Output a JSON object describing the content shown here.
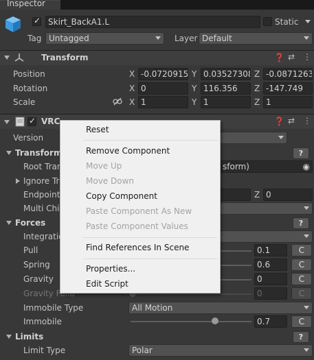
{
  "window": {
    "tab_title": "Inspector"
  },
  "header": {
    "object_name": "Skirt_BackA1.L",
    "static_label": "Static",
    "tag_label": "Tag",
    "tag_value": "Untagged",
    "layer_label": "Layer",
    "layer_value": "Default"
  },
  "transform": {
    "title": "Transform",
    "rows": [
      {
        "label": "Position",
        "x": "-0.0720915",
        "y": "0.03527308",
        "z": "-0.0871263"
      },
      {
        "label": "Rotation",
        "x": "0",
        "y": "116.356",
        "z": "-147.749"
      },
      {
        "label": "Scale",
        "x": "1",
        "y": "1",
        "z": "1"
      }
    ],
    "axis_x": "X",
    "axis_y": "Y",
    "axis_z": "Z"
  },
  "component": {
    "title_visible": "VRC",
    "version_label": "Version",
    "transforms_label": "Transform",
    "root_label": "Root Tran",
    "root_value": "sform)",
    "ignore_label": "Ignore Tra",
    "endpoint_label": "Endpoint",
    "endpoint_z_label": "Z",
    "endpoint_z": "0",
    "multi_label": "Multi Chil",
    "forces_label": "Forces",
    "integration_label": "Integratio",
    "pull_label": "Pull",
    "pull_value": "0.1",
    "spring_label": "Spring",
    "spring_value": "0.6",
    "gravity_label": "Gravity",
    "gravity_value": "0",
    "gravity_falloff_label": "Gravity Fallo",
    "gravity_falloff_value": "0",
    "immobile_type_label": "Immobile Type",
    "immobile_type_value": "All Motion",
    "immobile_label": "Immobile",
    "immobile_value": "0.7",
    "immobile_slider": 0.7,
    "limits_label": "Limits",
    "limit_type_label": "Limit Type",
    "limit_type_value": "Polar",
    "curve_button": "C",
    "help_button": "?"
  },
  "context_menu": {
    "items": [
      {
        "label": "Reset",
        "enabled": true
      },
      {
        "label": "Remove Component",
        "enabled": true
      },
      {
        "label": "Move Up",
        "enabled": false
      },
      {
        "label": "Move Down",
        "enabled": false
      },
      {
        "label": "Copy Component",
        "enabled": true
      },
      {
        "label": "Paste Component As New",
        "enabled": false
      },
      {
        "label": "Paste Component Values",
        "enabled": false
      },
      {
        "label": "Find References In Scene",
        "enabled": true
      },
      {
        "label": "Properties...",
        "enabled": true
      },
      {
        "label": "Edit Script",
        "enabled": true
      }
    ]
  },
  "colors": {
    "background": "#383838",
    "menu": "#f0f0f0",
    "cube_icon": "#4aa6e8"
  }
}
